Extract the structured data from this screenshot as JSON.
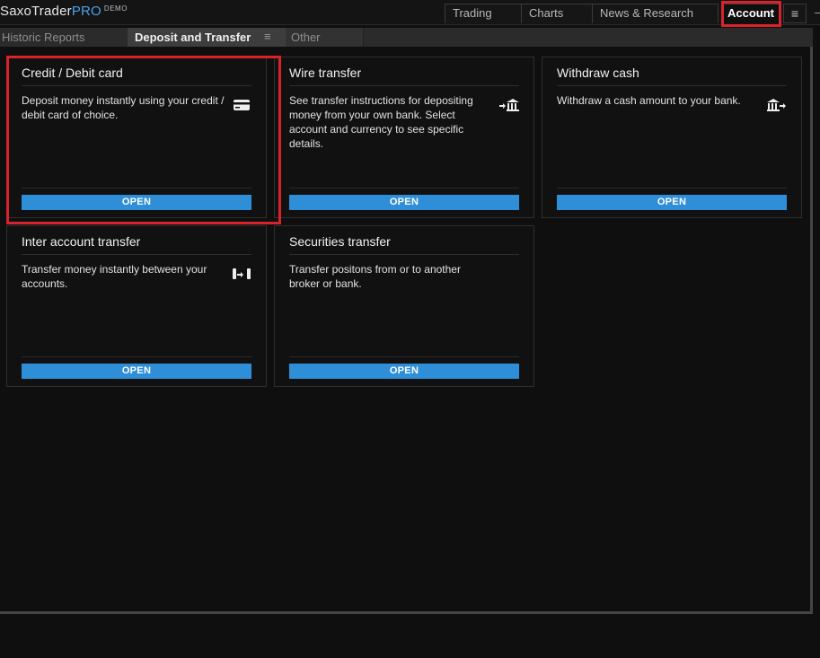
{
  "app": {
    "brand": "SaxoTrader",
    "brand_suffix": "PRO",
    "mode": "DEMO"
  },
  "main_tabs": [
    {
      "label": "Trading"
    },
    {
      "label": "Charts"
    },
    {
      "label": "News & Research"
    },
    {
      "label": "Account",
      "active": true
    }
  ],
  "menu_icon": "≡",
  "sub_tabs": [
    {
      "label": "Historic Reports"
    },
    {
      "label": "Deposit and Transfer",
      "active": true
    },
    {
      "label": "Other"
    }
  ],
  "cards": [
    {
      "title": "Credit / Debit card",
      "description": "Deposit money instantly using your credit / debit card of choice.",
      "icon": "credit-card-icon",
      "button": "OPEN"
    },
    {
      "title": "Wire transfer",
      "description": "See transfer instructions for depositing money from your own bank. Select account and currency to see specific details.",
      "icon": "bank-deposit-icon",
      "button": "OPEN"
    },
    {
      "title": "Withdraw cash",
      "description": "Withdraw a cash amount to your bank.",
      "icon": "bank-withdraw-icon",
      "button": "OPEN"
    },
    {
      "title": "Inter account transfer",
      "description": "Transfer money instantly between your accounts.",
      "icon": "inter-account-transfer-icon",
      "button": "OPEN"
    },
    {
      "title": "Securities transfer",
      "description": "Transfer positons from or to another broker or bank.",
      "icon": "",
      "button": "OPEN"
    }
  ],
  "colors": {
    "accent": "#2e8fd8",
    "highlight": "#d8232a",
    "background": "#0f0f0f"
  }
}
